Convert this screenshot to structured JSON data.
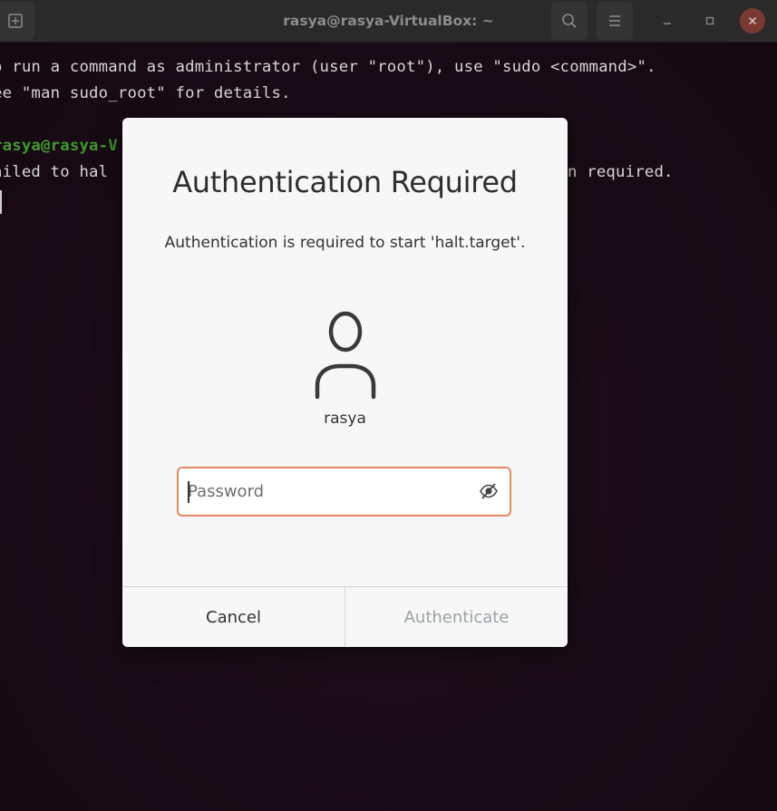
{
  "window": {
    "title": "rasya@rasya-VirtualBox: ~"
  },
  "terminal": {
    "line1": "o run a command as administrator (user \"root\"), use \"sudo <command>\".",
    "line2": "ee \"man sudo_root\" for details.",
    "prompt": "rasya@rasya-V",
    "line4_left": "ailed to hal",
    "line4_right": "n required."
  },
  "dialog": {
    "title": "Authentication Required",
    "message": "Authentication is required to start 'halt.target'.",
    "user": {
      "name": "rasya",
      "avatar_icon": "user-avatar-icon"
    },
    "password": {
      "value": "",
      "placeholder": "Password",
      "toggle_icon": "visibility-hidden-icon"
    },
    "cancel_label": "Cancel",
    "authenticate_label": "Authenticate"
  },
  "colors": {
    "focus_border": "#e9855f",
    "terminal_background": "#1b0c17",
    "prompt_green": "#3f9a2a",
    "close_button": "#7a3a32"
  }
}
